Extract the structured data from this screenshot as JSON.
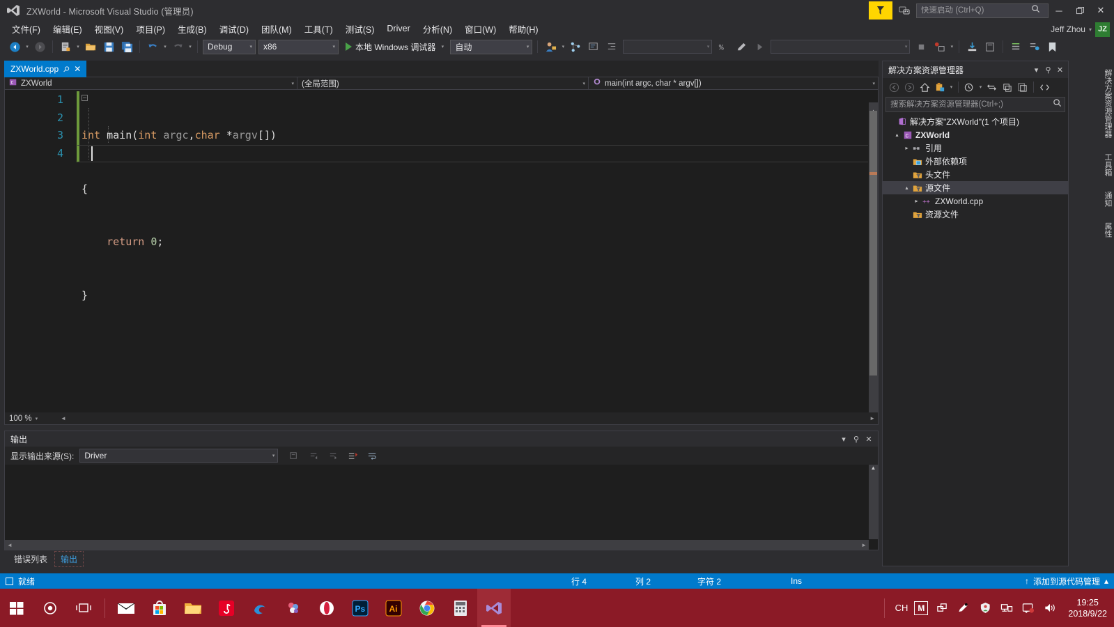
{
  "titlebar": {
    "title": "ZXWorld - Microsoft Visual Studio (管理员)",
    "logo_icon": "visual-studio-logo-icon",
    "flag_icon": "feedback-flag-icon",
    "notify_icon": "feedback-smiley-icon",
    "quicklaunch_placeholder": "快速启动 (Ctrl+Q)",
    "quicklaunch_value": "",
    "search_icon": "search-icon",
    "minimize_label": "─",
    "restore_label": "❐",
    "close_label": "✕"
  },
  "menubar": {
    "items": [
      {
        "label": "文件(F)"
      },
      {
        "label": "编辑(E)"
      },
      {
        "label": "视图(V)"
      },
      {
        "label": "项目(P)"
      },
      {
        "label": "生成(B)"
      },
      {
        "label": "调试(D)"
      },
      {
        "label": "团队(M)"
      },
      {
        "label": "工具(T)"
      },
      {
        "label": "测试(S)"
      },
      {
        "label": "Driver"
      },
      {
        "label": "分析(N)"
      },
      {
        "label": "窗口(W)"
      },
      {
        "label": "帮助(H)"
      }
    ],
    "user_name": "Jeff Zhou",
    "user_caret": "▾",
    "user_initials": "JZ"
  },
  "toolbar": {
    "nav_back_icon": "navigate-back-icon",
    "nav_forward_icon": "navigate-forward-icon",
    "new_project_icon": "new-project-icon",
    "open_file_icon": "open-file-icon",
    "save_icon": "save-icon",
    "save_all_icon": "save-all-icon",
    "undo_icon": "undo-icon",
    "redo_icon": "redo-icon",
    "config_value": "Debug",
    "platform_value": "x86",
    "run_label": "本地 Windows 调试器",
    "run_icon": "play-icon",
    "auto_value": "自动",
    "find_field_value": "",
    "find_in_files_value": "",
    "caret": "▾"
  },
  "editor": {
    "tab_label": "ZXWorld.cpp",
    "tab_pin_icon": "pin-icon",
    "tab_close_icon": "close-icon",
    "nav_project": "ZXWorld",
    "nav_project_icon": "project-cpp-icon",
    "nav_scope": "(全局范围)",
    "nav_member": "main(int argc, char * argv[])",
    "nav_member_icon": "method-icon",
    "caret": "▾",
    "line_numbers": [
      "1",
      "2",
      "3",
      "4"
    ],
    "code": {
      "line1": [
        {
          "t": "int",
          "c": "k-type"
        },
        {
          "t": " main",
          "c": "k-fn"
        },
        {
          "t": "(",
          "c": "k-plain"
        },
        {
          "t": "int",
          "c": "k-type"
        },
        {
          "t": " argc",
          "c": "k-ident"
        },
        {
          "t": ",",
          "c": "k-plain"
        },
        {
          "t": "char",
          "c": "k-type"
        },
        {
          "t": " *",
          "c": "k-plain"
        },
        {
          "t": "argv",
          "c": "k-ident"
        },
        {
          "t": "[])",
          "c": "k-plain"
        }
      ],
      "line2": [
        {
          "t": "{",
          "c": "k-plain"
        }
      ],
      "line3": [
        {
          "t": "    return",
          "c": "k-kw"
        },
        {
          "t": " ",
          "c": "k-plain"
        },
        {
          "t": "0",
          "c": "k-num"
        },
        {
          "t": ";",
          "c": "k-plain"
        }
      ],
      "line4": [
        {
          "t": "}",
          "c": "k-plain"
        }
      ]
    },
    "fold_glyph": "−",
    "zoom_level": "100 %"
  },
  "output": {
    "title": "输出",
    "dropdown_icon": "chevron-down-icon",
    "pin_icon": "pin-icon",
    "close_icon": "close-icon",
    "source_label": "显示输出来源(S):",
    "source_value": "Driver",
    "caret": "▾",
    "body_text": "",
    "tool_icons": [
      "find-message-icon",
      "go-to-previous-icon",
      "go-to-next-icon",
      "clear-all-icon",
      "toggle-word-wrap-icon"
    ]
  },
  "doc_tabs": {
    "items": [
      {
        "label": "错误列表",
        "selected": false
      },
      {
        "label": "输出",
        "selected": true
      }
    ]
  },
  "solution_explorer": {
    "title": "解决方案资源管理器",
    "dropdown_icon": "chevron-down-icon",
    "pin_icon": "pin-icon",
    "close_icon": "close-icon",
    "search_placeholder": "搜索解决方案资源管理器(Ctrl+;)",
    "search_value": "",
    "search_icon": "search-icon",
    "toolbar_icons": [
      "back-icon",
      "forward-icon",
      "home-icon",
      "pending-changes-filter-icon",
      "sync-with-active-document-icon",
      "refresh-icon",
      "collapse-all-icon",
      "show-all-files-icon",
      "properties-icon",
      "view-code-icon"
    ],
    "tree": [
      {
        "indent": 0,
        "expander": "",
        "icon": "solution-icon",
        "label": "解决方案\"ZXWorld\"(1 个项目)",
        "bold": false,
        "selected": false
      },
      {
        "indent": 1,
        "expander": "▴",
        "icon": "project-cpp-icon",
        "label": "ZXWorld",
        "bold": true,
        "selected": false
      },
      {
        "indent": 2,
        "expander": "▸",
        "icon": "references-icon",
        "label": "引用",
        "bold": false,
        "selected": false
      },
      {
        "indent": 2,
        "expander": "",
        "icon": "external-deps-icon",
        "label": "外部依赖项",
        "bold": false,
        "selected": false
      },
      {
        "indent": 2,
        "expander": "",
        "icon": "folder-filter-icon",
        "label": "头文件",
        "bold": false,
        "selected": false
      },
      {
        "indent": 2,
        "expander": "▴",
        "icon": "folder-filter-icon",
        "label": "源文件",
        "bold": false,
        "selected": true
      },
      {
        "indent": 3,
        "expander": "▸",
        "icon": "cpp-file-icon",
        "label": "ZXWorld.cpp",
        "bold": false,
        "selected": false
      },
      {
        "indent": 2,
        "expander": "",
        "icon": "folder-filter-icon",
        "label": "资源文件",
        "bold": false,
        "selected": false
      }
    ]
  },
  "right_dock": {
    "tabs": [
      {
        "label": "解决方案资源管理器"
      },
      {
        "label": "工具箱"
      },
      {
        "label": "通知"
      },
      {
        "label": "属性"
      }
    ]
  },
  "statusbar": {
    "ready": "就绪",
    "line_label": "行 4",
    "col_label": "列 2",
    "char_label": "字符 2",
    "ins_label": "Ins",
    "source_control": "添加到源代码管理",
    "upload_icon": "upload-arrow-icon",
    "expand_icon": "chevron-up-icon"
  },
  "taskbar": {
    "items": [
      {
        "icon": "windows-start-icon",
        "active": false
      },
      {
        "icon": "cortana-search-icon",
        "active": false
      },
      {
        "icon": "task-view-icon",
        "active": false
      },
      {
        "icon": "mail-icon",
        "active": false
      },
      {
        "icon": "microsoft-store-icon",
        "active": false
      },
      {
        "icon": "file-explorer-icon",
        "active": false
      },
      {
        "icon": "netease-music-icon",
        "active": false
      },
      {
        "icon": "edge-browser-icon",
        "active": false
      },
      {
        "icon": "paint-icon",
        "active": false
      },
      {
        "icon": "opera-icon",
        "active": false
      },
      {
        "icon": "photoshop-icon",
        "active": false
      },
      {
        "icon": "illustrator-icon",
        "active": false
      },
      {
        "icon": "chrome-icon",
        "active": false
      },
      {
        "icon": "calculator-icon",
        "active": false
      },
      {
        "icon": "visual-studio-icon",
        "active": true
      }
    ],
    "tray": {
      "ime_label": "CH",
      "ime_mode": "M",
      "icons": [
        "share-icon",
        "pen-tablet-icon",
        "security-shield-icon",
        "network-icon",
        "action-center-icon",
        "volume-icon"
      ],
      "time": "19:25",
      "date": "2018/9/22"
    }
  }
}
